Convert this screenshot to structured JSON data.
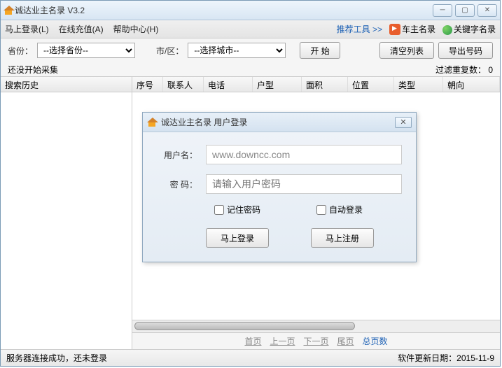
{
  "window": {
    "title": "诚达业主名录 V3.2"
  },
  "menubar": {
    "login": "马上登录(L)",
    "recharge": "在线充值(A)",
    "help": "帮助中心(H)",
    "recommend": "推荐工具 >>",
    "car_dir": "车主名录",
    "keyword_dir": "关键字名录"
  },
  "toolbar": {
    "province_label": "省份：",
    "province_value": "--选择省份--",
    "city_label": "市/区：",
    "city_value": "--选择城市--",
    "start": "开 始",
    "clear": "清空列表",
    "export": "导出号码"
  },
  "status": {
    "collect": "还没开始采集",
    "filter_label": "过滤重复数：",
    "filter_count": "0"
  },
  "sidebar": {
    "header": "搜索历史"
  },
  "table": {
    "headers": [
      "序号",
      "联系人",
      "电话",
      "户型",
      "面积",
      "位置",
      "类型",
      "朝向"
    ]
  },
  "pager": {
    "first": "首页",
    "prev": "上一页",
    "next": "下一页",
    "last": "尾页",
    "total": "总页数"
  },
  "statusbar": {
    "left": "服务器连接成功，还未登录",
    "right_label": "软件更新日期：",
    "date": "2015-11-9"
  },
  "dialog": {
    "title": "诚达业主名录 用户登录",
    "username_label": "用户名：",
    "username_value": "www.downcc.com",
    "password_label": "密  码：",
    "password_placeholder": "请输入用户密码",
    "remember": "记住密码",
    "autologin": "自动登录",
    "login_btn": "马上登录",
    "register_btn": "马上注册"
  }
}
